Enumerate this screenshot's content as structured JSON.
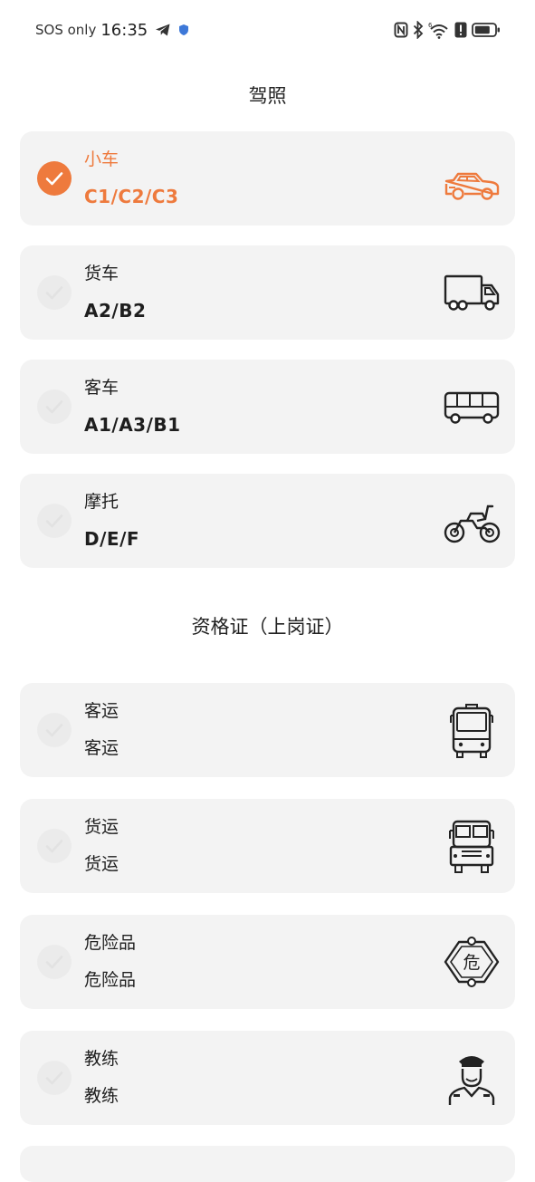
{
  "status_bar": {
    "sos": "SOS only",
    "time": "16:35"
  },
  "license_section": {
    "title": "驾照",
    "items": [
      {
        "name": "小车",
        "code": "C1/C2/C3",
        "icon": "car-icon",
        "selected": true
      },
      {
        "name": "货车",
        "code": "A2/B2",
        "icon": "truck-icon",
        "selected": false
      },
      {
        "name": "客车",
        "code": "A1/A3/B1",
        "icon": "bus-icon",
        "selected": false
      },
      {
        "name": "摩托",
        "code": "D/E/F",
        "icon": "motorcycle-icon",
        "selected": false
      }
    ]
  },
  "qualification_section": {
    "title": "资格证（上岗证）",
    "items": [
      {
        "name": "客运",
        "sub": "客运",
        "icon": "coach-front-icon",
        "selected": false
      },
      {
        "name": "货运",
        "sub": "货运",
        "icon": "freight-truck-front-icon",
        "selected": false
      },
      {
        "name": "危险品",
        "sub": "危险品",
        "icon": "hazard-sign-icon",
        "icon_text": "危",
        "selected": false
      },
      {
        "name": "教练",
        "sub": "教练",
        "icon": "instructor-icon",
        "selected": false
      }
    ]
  },
  "colors": {
    "accent": "#ee7a3d",
    "card_bg": "#f3f3f3",
    "text": "#1e1e1e"
  }
}
